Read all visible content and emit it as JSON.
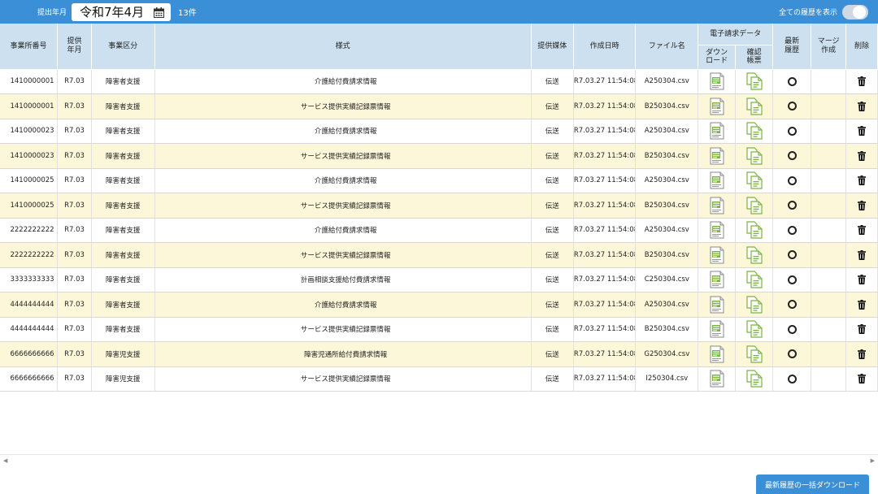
{
  "header": {
    "submit_label": "提出年月",
    "date_value": "令和7年4月",
    "count": "13件",
    "toggle_label": "全ての履歴を表示"
  },
  "columns": {
    "office_no": "事業所番号",
    "provide_ym": "提供年月",
    "category": "事業区分",
    "form": "様式",
    "media": "提供媒体",
    "created": "作成日時",
    "filename": "ファイル名",
    "edata": "電子請求データ",
    "download": "ダウンロード",
    "confirm": "確認帳票",
    "latest": "最新履歴",
    "merge": "マージ作成",
    "delete": "削除"
  },
  "rows": [
    {
      "id": "1410000001",
      "ym": "R7.03",
      "cat": "障害者支援",
      "form": "介護給付費請求情報",
      "media": "伝送",
      "created": "R7.03.27 11:54:08",
      "file": "A250304.csv"
    },
    {
      "id": "1410000001",
      "ym": "R7.03",
      "cat": "障害者支援",
      "form": "サービス提供実績記録票情報",
      "media": "伝送",
      "created": "R7.03.27 11:54:08",
      "file": "B250304.csv"
    },
    {
      "id": "1410000023",
      "ym": "R7.03",
      "cat": "障害者支援",
      "form": "介護給付費請求情報",
      "media": "伝送",
      "created": "R7.03.27 11:54:08",
      "file": "A250304.csv"
    },
    {
      "id": "1410000023",
      "ym": "R7.03",
      "cat": "障害者支援",
      "form": "サービス提供実績記録票情報",
      "media": "伝送",
      "created": "R7.03.27 11:54:08",
      "file": "B250304.csv"
    },
    {
      "id": "1410000025",
      "ym": "R7.03",
      "cat": "障害者支援",
      "form": "介護給付費請求情報",
      "media": "伝送",
      "created": "R7.03.27 11:54:08",
      "file": "A250304.csv"
    },
    {
      "id": "1410000025",
      "ym": "R7.03",
      "cat": "障害者支援",
      "form": "サービス提供実績記録票情報",
      "media": "伝送",
      "created": "R7.03.27 11:54:08",
      "file": "B250304.csv"
    },
    {
      "id": "2222222222",
      "ym": "R7.03",
      "cat": "障害者支援",
      "form": "介護給付費請求情報",
      "media": "伝送",
      "created": "R7.03.27 11:54:08",
      "file": "A250304.csv"
    },
    {
      "id": "2222222222",
      "ym": "R7.03",
      "cat": "障害者支援",
      "form": "サービス提供実績記録票情報",
      "media": "伝送",
      "created": "R7.03.27 11:54:08",
      "file": "B250304.csv"
    },
    {
      "id": "3333333333",
      "ym": "R7.03",
      "cat": "障害者支援",
      "form": "計画相談支援給付費請求情報",
      "media": "伝送",
      "created": "R7.03.27 11:54:08",
      "file": "C250304.csv"
    },
    {
      "id": "4444444444",
      "ym": "R7.03",
      "cat": "障害者支援",
      "form": "介護給付費請求情報",
      "media": "伝送",
      "created": "R7.03.27 11:54:08",
      "file": "A250304.csv"
    },
    {
      "id": "4444444444",
      "ym": "R7.03",
      "cat": "障害者支援",
      "form": "サービス提供実績記録票情報",
      "media": "伝送",
      "created": "R7.03.27 11:54:08",
      "file": "B250304.csv"
    },
    {
      "id": "6666666666",
      "ym": "R7.03",
      "cat": "障害児支援",
      "form": "障害児通所給付費請求情報",
      "media": "伝送",
      "created": "R7.03.27 11:54:08",
      "file": "G250304.csv"
    },
    {
      "id": "6666666666",
      "ym": "R7.03",
      "cat": "障害児支援",
      "form": "サービス提供実績記録票情報",
      "media": "伝送",
      "created": "R7.03.27 11:54:08",
      "file": "I250304.csv"
    }
  ],
  "footer": {
    "bulk_download": "最新履歴の一括ダウンロード"
  },
  "icons": {
    "download": "download-document-icon",
    "confirm": "confirm-document-icon",
    "latest": "latest-circle-icon",
    "delete": "trash-icon",
    "calendar": "calendar-icon"
  },
  "colors": {
    "header_bar": "#3a8fd6",
    "table_header": "#cce0ef",
    "row_alt": "#fdf7d9",
    "icon_green": "#7cb342"
  }
}
